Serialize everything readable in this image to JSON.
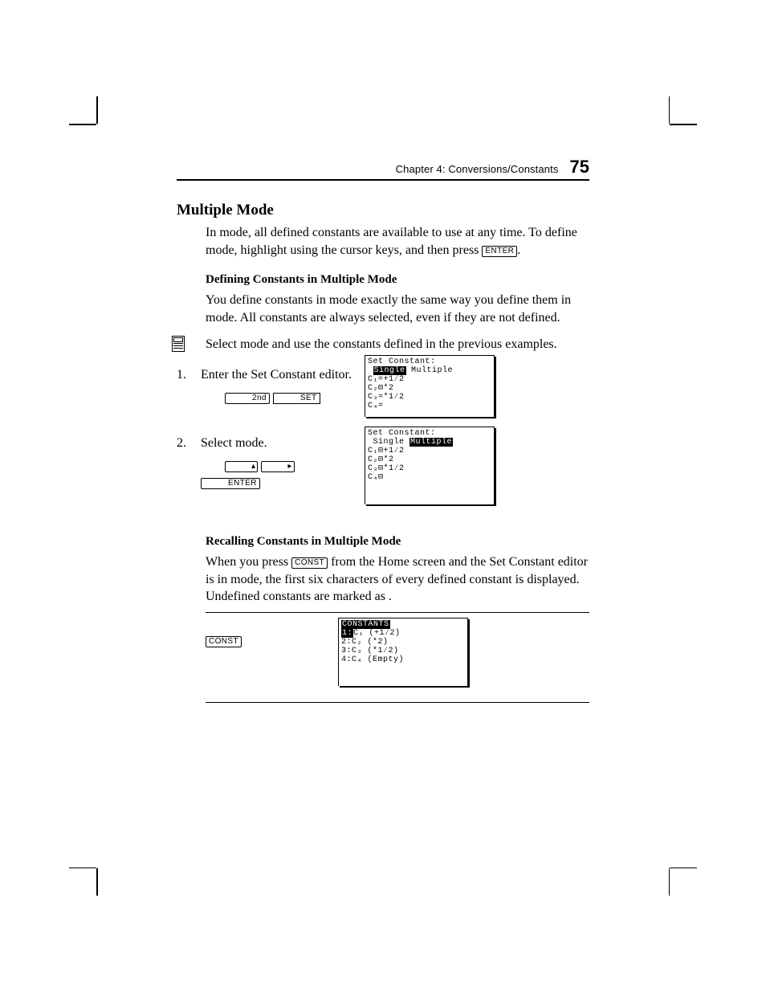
{
  "header": {
    "chapter_label": "Chapter 4: Conversions/Constants",
    "page_number": "75"
  },
  "section": {
    "title": "Multiple Mode",
    "intro_before_mode": "In ",
    "intro_after_mode_before_define": " mode, all defined constants are available to use at any time. To define ",
    "intro_after_define_before_highlight": " mode, highlight ",
    "intro_after_highlight": " using the cursor keys, and then press ",
    "intro_period": "."
  },
  "keys": {
    "enter": "ENTER",
    "second": "2nd",
    "set": "SET",
    "const": "CONST",
    "up": "▴",
    "right": "▸"
  },
  "defining": {
    "heading": "Defining Constants in Multiple Mode",
    "p_before1": "You define constants in ",
    "p_after1": " mode exactly the same way you define them in ",
    "p_after2": " mode. All constants are always selected, even if they are not defined."
  },
  "example": {
    "lead_before": "Select ",
    "lead_after": " mode and use the constants defined in the previous examples.",
    "step1_num": "1.",
    "step1_text": "Enter the Set Constant editor.",
    "step2_num": "2.",
    "step2_text_before": "Select ",
    "step2_text_after": " mode."
  },
  "screens": {
    "single": "Set Constant:\n Single Multiple\nC₁=+1⁄2\nC₂⊟*2\nC₃=*1⁄2\nC₄=",
    "single_inv": "Single",
    "multiple": "Set Constant:\n Single Multiple\nC₁⊟+1⁄2\nC₂⊟*2\nC₃⊟*1⁄2\nC₄⊟",
    "multiple_inv": "Multiple",
    "constants_menu_title": "CONSTANTS",
    "constants_menu_rows": [
      "1:C₁ (+1⁄2)",
      "2:C₂ (*2)",
      "3:C₃ (*1⁄2)",
      "4:C₄ (Empty)"
    ]
  },
  "recalling": {
    "heading": "Recalling Constants in Multiple Mode",
    "p_before": "When you press ",
    "p_mid1": " from the Home screen and the Set Constant editor is in ",
    "p_mid2": " mode, the first six characters of every defined constant is displayed. Undefined constants are marked as ",
    "p_after": "."
  }
}
